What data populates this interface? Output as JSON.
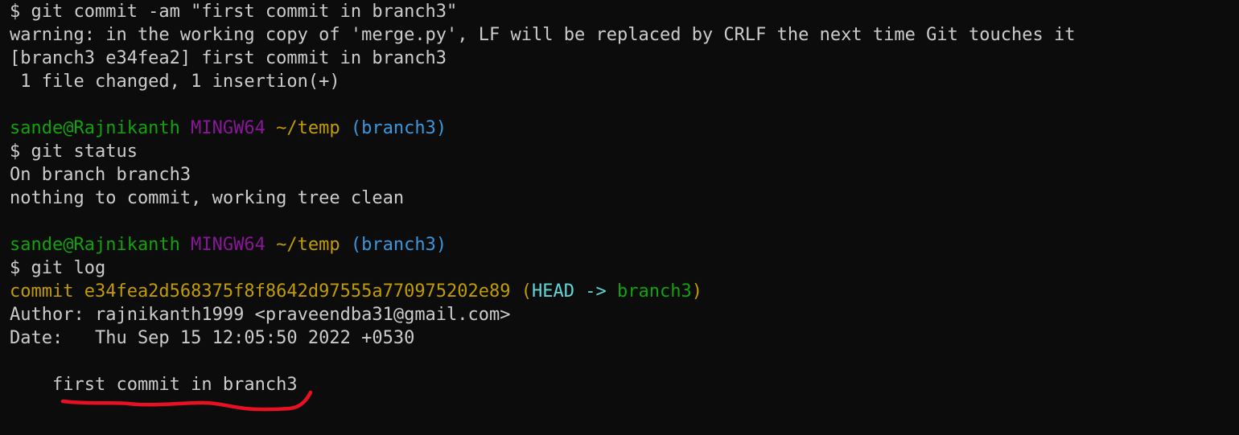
{
  "terminal": {
    "colors": {
      "background": "#0c0c0c",
      "text": "#cccccc",
      "user": "#13a10e",
      "mingw": "#881798",
      "path": "#c19c00",
      "branch": "#3a96dd",
      "commit": "#c19c00",
      "head": "#61d6d6",
      "annotation": "#e81123"
    },
    "lines": {
      "l1": "$ git commit -am \"first commit in branch3\"",
      "l2": "warning: in the working copy of 'merge.py', LF will be replaced by CRLF the next time Git touches it",
      "l3": "[branch3 e34fea2] first commit in branch3",
      "l4": " 1 file changed, 1 insertion(+)",
      "p1_user": "sande@Rajnikanth",
      "p1_mingw": "MINGW64",
      "p1_path": "~/temp",
      "p1_branch": "(branch3)",
      "l7": "$ git status",
      "l8": "On branch branch3",
      "l9": "nothing to commit, working tree clean",
      "p2_user": "sande@Rajnikanth",
      "p2_mingw": "MINGW64",
      "p2_path": "~/temp",
      "p2_branch": "(branch3)",
      "l12": "$ git log",
      "commit_word": "commit e34fea2d568375f8f8642d97555a770975202e89",
      "commit_open": "(",
      "commit_head": "HEAD ->",
      "commit_branch": "branch3",
      "commit_close": ")",
      "author": "Author: rajnikanth1999 <praveendba31@gmail.com>",
      "date": "Date:   Thu Sep 15 12:05:50 2022 +0530",
      "message": "    first commit in branch3"
    }
  }
}
